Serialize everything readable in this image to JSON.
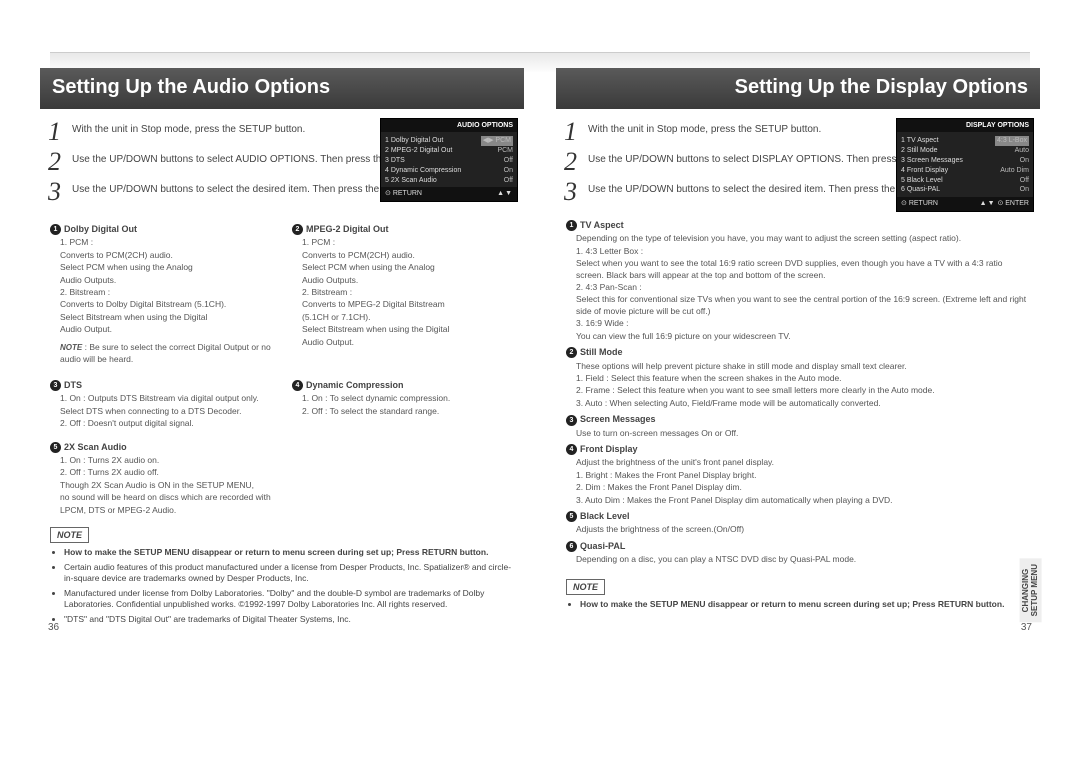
{
  "left": {
    "title": "Setting Up the Audio Options",
    "steps": [
      "With the unit in Stop mode, press the SETUP button.",
      "Use the UP/DOWN buttons to select AUDIO OPTIONS. Then press the ENTER button.",
      "Use the UP/DOWN buttons to select the desired item. Then press the LEFT/RIGHT buttons."
    ],
    "osd": {
      "title": "AUDIO OPTIONS",
      "rows": [
        {
          "l": "1  Dolby Digital Out",
          "v": "◀▶ PCM",
          "sel": true
        },
        {
          "l": "2  MPEG-2 Digital Out",
          "v": "PCM"
        },
        {
          "l": "3  DTS",
          "v": "Off"
        },
        {
          "l": "4  Dynamic Compression",
          "v": "On"
        },
        {
          "l": "5  2X Scan Audio",
          "v": "Off"
        }
      ],
      "return": "RETURN",
      "arrows": "▲▼"
    },
    "dd_title": "Dolby Digital Out",
    "dd": [
      "1. PCM :",
      "Converts to PCM(2CH) audio.",
      "Select PCM when using the Analog",
      "Audio Outputs.",
      "2. Bitstream :",
      "Converts to Dolby Digital Bitstream (5.1CH).",
      "Select Bitstream when using the Digital",
      "Audio Output."
    ],
    "dd_note_label": "NOTE",
    "dd_note": " : Be sure to select the correct Digital Output or no audio will be heard.",
    "mp_title": "MPEG-2 Digital Out",
    "mp": [
      "1. PCM :",
      "Converts to PCM(2CH) audio.",
      "Select PCM when using the Analog",
      "Audio Outputs.",
      "2. Bitstream :",
      "Converts to MPEG-2 Digital Bitstream",
      "(5.1CH or 7.1CH).",
      "Select Bitstream when using the Digital",
      "Audio Output."
    ],
    "dts_title": "DTS",
    "dts": [
      "1. On : Outputs DTS Bitstream via digital output only.",
      "    Select DTS when connecting to a DTS Decoder.",
      "2. Off : Doesn't output digital signal."
    ],
    "dc_title": "Dynamic Compression",
    "dc": [
      "1. On : To select dynamic compression.",
      "2. Off : To select the standard range."
    ],
    "sx_title": "2X Scan Audio",
    "sx": [
      "1. On : Turns 2X audio on.",
      "2. Off : Turns 2X audio off.",
      "Though 2X Scan Audio is ON in the SETUP MENU,",
      "no sound will be heard on discs which are recorded with",
      "LPCM, DTS or MPEG-2 Audio."
    ],
    "note_label": "NOTE",
    "notes": [
      "How to make the SETUP MENU disappear or return to menu screen during set up;  Press RETURN button.",
      "Certain audio features of this product manufactured under a license from Desper Products, Inc. Spatializer® and circle-in-square device are trademarks owned by Desper Products, Inc.",
      "Manufactured under license from Dolby Laboratories. \"Dolby\" and the double-D symbol are trademarks of Dolby Laboratories. Confidential unpublished works. ©1992-1997 Dolby Laboratories Inc. All rights reserved.",
      "\"DTS\" and \"DTS Digital Out\" are trademarks of Digital Theater Systems, Inc."
    ],
    "pagenum": "36"
  },
  "right": {
    "title": "Setting Up the Display Options",
    "steps": [
      "With the unit in Stop mode, press the SETUP button.",
      "Use the UP/DOWN buttons to select DISPLAY OPTIONS. Then press the ENTER button.",
      "Use the UP/DOWN buttons to select the desired item. Then press the LEFT/RIGHT buttons."
    ],
    "osd": {
      "title": "DISPLAY OPTIONS",
      "rows": [
        {
          "l": "1  TV Aspect",
          "v": "4:3  L-Box",
          "sel": true
        },
        {
          "l": "2  Still Mode",
          "v": "Auto"
        },
        {
          "l": "3  Screen Messages",
          "v": "On"
        },
        {
          "l": "4  Front Display",
          "v": "Auto Dim"
        },
        {
          "l": "5  Black Level",
          "v": "Off"
        },
        {
          "l": "6  Quasi-PAL",
          "v": "On"
        }
      ],
      "return": "RETURN",
      "arrows": "▲▼",
      "enter": "ENTER"
    },
    "items": [
      {
        "n": "1",
        "t": "TV Aspect",
        "body": [
          "Depending on the type of television you have, you may want to adjust the screen setting (aspect ratio).",
          "1. 4:3 Letter Box :",
          "   Select when you want to see the total 16:9 ratio screen DVD supplies, even though you have a TV with a 4:3 ratio screen. Black bars will appear at the top and bottom of the screen.",
          "2. 4:3 Pan-Scan :",
          "   Select this for conventional size TVs when you want to see the central portion of the 16:9 screen. (Extreme left and right side of movie picture will be cut off.)",
          "3. 16:9 Wide :",
          "   You can view the full 16:9 picture on your widescreen TV."
        ]
      },
      {
        "n": "2",
        "t": "Still Mode",
        "body": [
          "These options will help prevent picture shake in still mode and display small text clearer.",
          "1. Field : Select this feature when the screen shakes in the Auto mode.",
          "2. Frame : Select this feature when you want to see small letters more clearly in the Auto mode.",
          "3. Auto : When selecting Auto, Field/Frame mode will be automatically converted."
        ]
      },
      {
        "n": "3",
        "t": "Screen Messages",
        "body": [
          "Use to turn on-screen messages On or Off."
        ]
      },
      {
        "n": "4",
        "t": "Front Display",
        "body": [
          "Adjust the brightness of the unit's front panel display.",
          "1. Bright : Makes the Front Panel Display bright.",
          "2. Dim : Makes the Front Panel Display dim.",
          "3. Auto Dim : Makes the Front Panel Display dim automatically when playing a DVD."
        ]
      },
      {
        "n": "5",
        "t": "Black Level",
        "body": [
          "Adjusts the brightness of the screen.(On/Off)"
        ]
      },
      {
        "n": "6",
        "t": "Quasi-PAL",
        "body": [
          "Depending on a disc, you can play a NTSC DVD disc by Quasi-PAL mode."
        ]
      }
    ],
    "note_label": "NOTE",
    "notes": [
      "How to make the SETUP MENU disappear or return to menu screen during set up;  Press RETURN button."
    ],
    "sidetab1": "CHANGING",
    "sidetab2": "SETUP MENU",
    "pagenum": "37"
  }
}
